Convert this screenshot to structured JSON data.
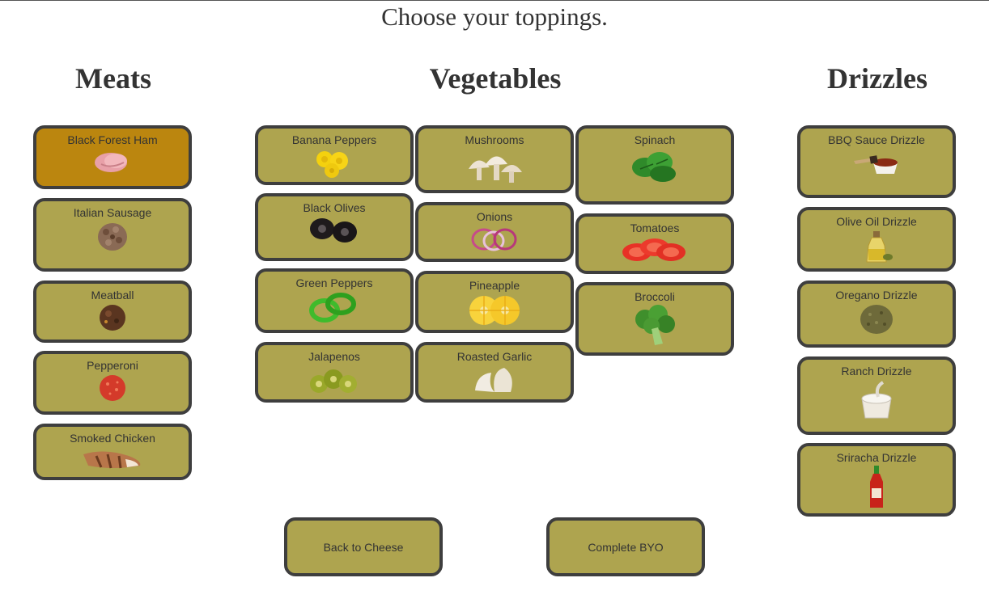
{
  "title": "Choose your toppings.",
  "categories": {
    "meats": "Meats",
    "vegetables": "Vegetables",
    "drizzles": "Drizzles"
  },
  "meats": [
    "Black Forest Ham",
    "Italian Sausage",
    "Meatball",
    "Pepperoni",
    "Smoked Chicken"
  ],
  "vegetables": [
    "Banana Peppers",
    "Mushrooms",
    "Spinach",
    "Black Olives",
    "Onions",
    "Tomatoes",
    "Green Peppers",
    "Pineapple",
    "Broccoli",
    "Jalapenos",
    "Roasted Garlic"
  ],
  "drizzles": [
    "BBQ Sauce Drizzle",
    "Olive Oil Drizzle",
    "Oregano Drizzle",
    "Ranch Drizzle",
    "Sriracha Drizzle"
  ],
  "buttons": {
    "back": "Back to Cheese",
    "complete": "Complete BYO"
  },
  "selected": [
    "Black Forest Ham"
  ],
  "colors": {
    "tile": "#aea44f",
    "tile_selected": "#bb860f",
    "border": "#3e3e3e"
  }
}
